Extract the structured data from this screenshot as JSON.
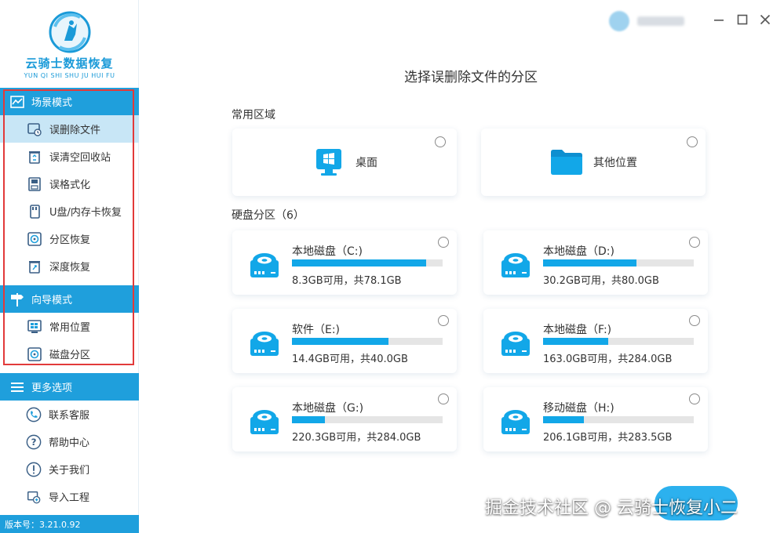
{
  "app": {
    "title": "云骑士数据恢复",
    "subtitle": "YUN QI SHI SHU JU HUI FU",
    "version": "版本号：3.21.0.92",
    "brand_color": "#1f9fdc",
    "highlight_color": "#e23a3a"
  },
  "sidebar": {
    "scene_mode": {
      "title": "场景模式",
      "items": [
        {
          "label": "误删除文件",
          "icon": "deleted-file-icon",
          "active": true
        },
        {
          "label": "误清空回收站",
          "icon": "recycle-bin-icon"
        },
        {
          "label": "误格式化",
          "icon": "format-disk-icon"
        },
        {
          "label": "U盘/内存卡恢复",
          "icon": "usb-card-icon"
        },
        {
          "label": "分区恢复",
          "icon": "partition-icon"
        },
        {
          "label": "深度恢复",
          "icon": "deep-recovery-icon"
        }
      ]
    },
    "guide_mode": {
      "title": "向导模式",
      "items": [
        {
          "label": "常用位置",
          "icon": "windows-icon"
        },
        {
          "label": "磁盘分区",
          "icon": "disk-partition-icon"
        }
      ]
    },
    "more": {
      "title": "更多选项",
      "items": [
        {
          "label": "联系客服",
          "icon": "phone-icon"
        },
        {
          "label": "帮助中心",
          "icon": "help-icon"
        },
        {
          "label": "关于我们",
          "icon": "info-icon"
        },
        {
          "label": "导入工程",
          "icon": "import-icon"
        }
      ]
    }
  },
  "window": {
    "minimize_icon": "minimize-icon",
    "maximize_icon": "maximize-icon",
    "close_icon": "close-icon"
  },
  "main": {
    "title": "选择误删除文件的分区",
    "common_label": "常用区域",
    "common": [
      {
        "label": "桌面",
        "icon": "desktop-icon"
      },
      {
        "label": "其他位置",
        "icon": "folder-icon"
      }
    ],
    "disk_label": "硬盘分区（6）",
    "disks": [
      {
        "name": "本地磁盘（C:)",
        "info": "8.3GB可用，共78.1GB",
        "used_fraction": 0.89
      },
      {
        "name": "本地磁盘（D:)",
        "info": "30.2GB可用，共80.0GB",
        "used_fraction": 0.62
      },
      {
        "name": "软件（E:)",
        "info": "14.4GB可用，共40.0GB",
        "used_fraction": 0.64
      },
      {
        "name": "本地磁盘（F:)",
        "info": "163.0GB可用，共284.0GB",
        "used_fraction": 0.43
      },
      {
        "name": "本地磁盘（G:)",
        "info": "220.3GB可用，共284.0GB",
        "used_fraction": 0.22
      },
      {
        "name": "移动磁盘（H:)",
        "info": "206.1GB可用，共283.5GB",
        "used_fraction": 0.27
      }
    ]
  },
  "watermark": "掘金技术社区 @ 云骑士恢复小二"
}
